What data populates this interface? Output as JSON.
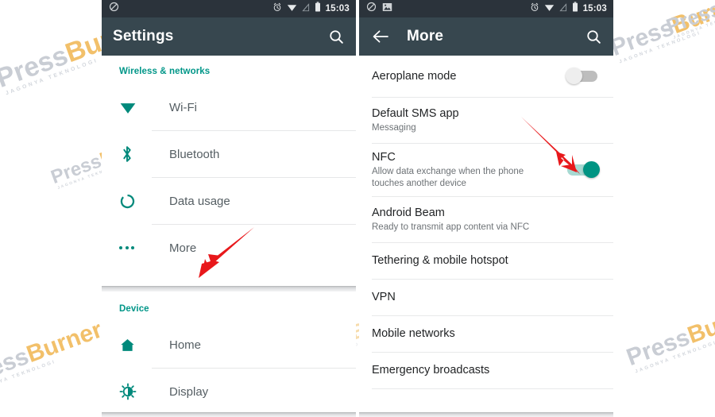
{
  "watermark": {
    "text_part1": "Press",
    "text_part2": "Burner",
    "subtitle": "JAGONYA TEKNOLOGI"
  },
  "colors": {
    "accent_teal": "#009688",
    "appbar": "#37474f",
    "statusbar": "#2b333b",
    "arrow_red": "#e8181b",
    "toggle_on": "#009483",
    "toggle_off": "#bdbdbd"
  },
  "left_phone": {
    "status_bar": {
      "time": "15:03",
      "left_icons": [
        "do-not-disturb-icon"
      ],
      "right_icons": [
        "alarm-icon",
        "wifi-icon",
        "signal-off-icon",
        "battery-icon"
      ]
    },
    "app_bar": {
      "title": "Settings",
      "search_icon": "search-icon"
    },
    "sections": [
      {
        "header": "Wireless & networks",
        "items": [
          {
            "icon": "wifi-icon",
            "label": "Wi-Fi"
          },
          {
            "icon": "bluetooth-icon",
            "label": "Bluetooth"
          },
          {
            "icon": "data-usage-icon",
            "label": "Data usage"
          },
          {
            "icon": "more-dots-icon",
            "label": "More"
          }
        ]
      },
      {
        "header": "Device",
        "items": [
          {
            "icon": "home-icon",
            "label": "Home"
          },
          {
            "icon": "display-brightness-icon",
            "label": "Display"
          }
        ]
      }
    ]
  },
  "right_phone": {
    "status_bar": {
      "time": "15:03",
      "left_icons": [
        "do-not-disturb-icon",
        "screenshot-image-icon"
      ],
      "right_icons": [
        "alarm-icon",
        "wifi-icon",
        "signal-off-icon",
        "battery-icon"
      ]
    },
    "app_bar": {
      "back_icon": "back-arrow-icon",
      "title": "More",
      "search_icon": "search-icon"
    },
    "items": [
      {
        "title": "Aeroplane mode",
        "subtitle": "",
        "control": "toggle",
        "toggle_state": "off"
      },
      {
        "title": "Default SMS app",
        "subtitle": "Messaging",
        "control": "none",
        "toggle_state": ""
      },
      {
        "title": "NFC",
        "subtitle": "Allow data exchange when the phone touches another device",
        "control": "toggle",
        "toggle_state": "on"
      },
      {
        "title": "Android Beam",
        "subtitle": "Ready to transmit app content via NFC",
        "control": "none",
        "toggle_state": ""
      },
      {
        "title": "Tethering & mobile hotspot",
        "subtitle": "",
        "control": "none",
        "toggle_state": ""
      },
      {
        "title": "VPN",
        "subtitle": "",
        "control": "none",
        "toggle_state": ""
      },
      {
        "title": "Mobile networks",
        "subtitle": "",
        "control": "none",
        "toggle_state": ""
      },
      {
        "title": "Emergency broadcasts",
        "subtitle": "",
        "control": "none",
        "toggle_state": ""
      }
    ]
  },
  "annotations": [
    {
      "name": "arrow-pointing-to-more",
      "target": "More"
    },
    {
      "name": "arrow-pointing-to-nfc-toggle",
      "target": "NFC"
    }
  ]
}
